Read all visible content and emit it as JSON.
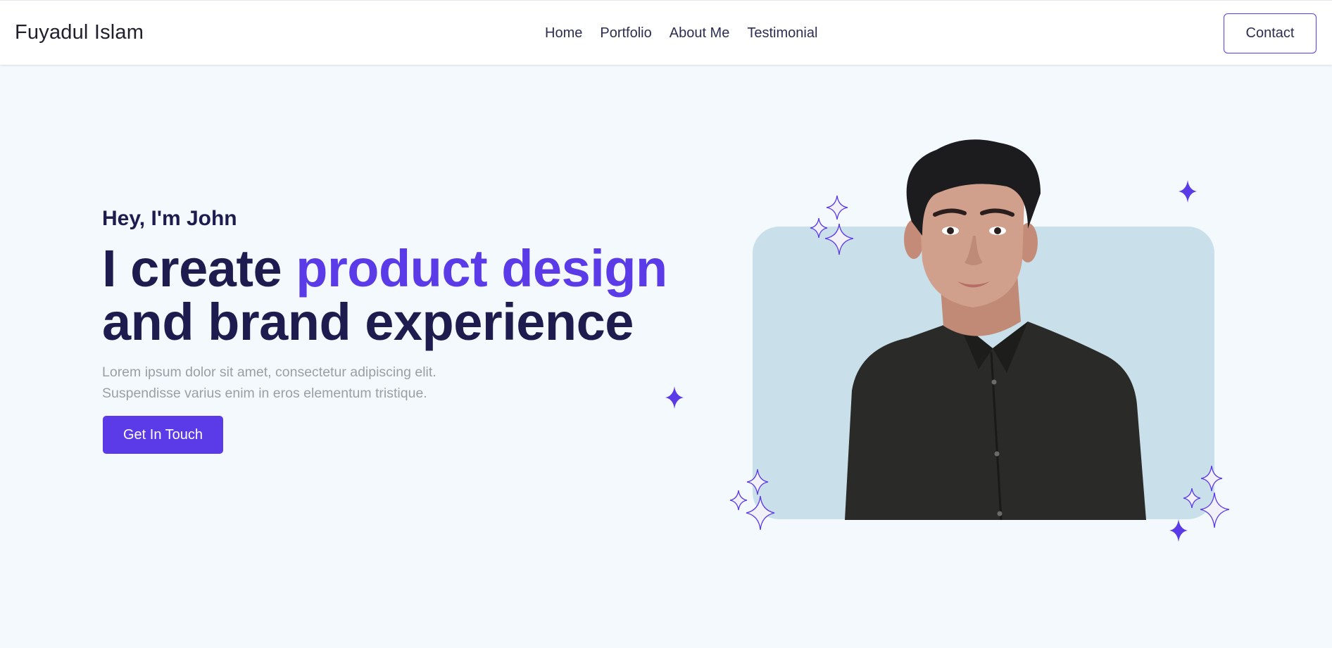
{
  "header": {
    "brand": "Fuyadul Islam",
    "nav": [
      {
        "label": "Home"
      },
      {
        "label": "Portfolio"
      },
      {
        "label": "About Me"
      },
      {
        "label": "Testimonial"
      }
    ],
    "contact_label": "Contact"
  },
  "hero": {
    "greeting": "Hey, I'm John",
    "headline_start": "I create ",
    "headline_accent": "product design",
    "headline_end": "and brand experience",
    "description_line1": "Lorem ipsum dolor sit amet, consectetur adipiscing elit.",
    "description_line2": "Suspendisse varius enim in eros elementum tristique.",
    "cta_label": "Get In Touch"
  },
  "colors": {
    "accent": "#5b3be8",
    "heading": "#1e1c4f",
    "background": "#f4f9fd",
    "card": "#c9dfe9",
    "muted_text": "#9a9fa6"
  },
  "icons": {
    "sparkle": "four-point-star-icon",
    "portrait": "person-photo"
  }
}
